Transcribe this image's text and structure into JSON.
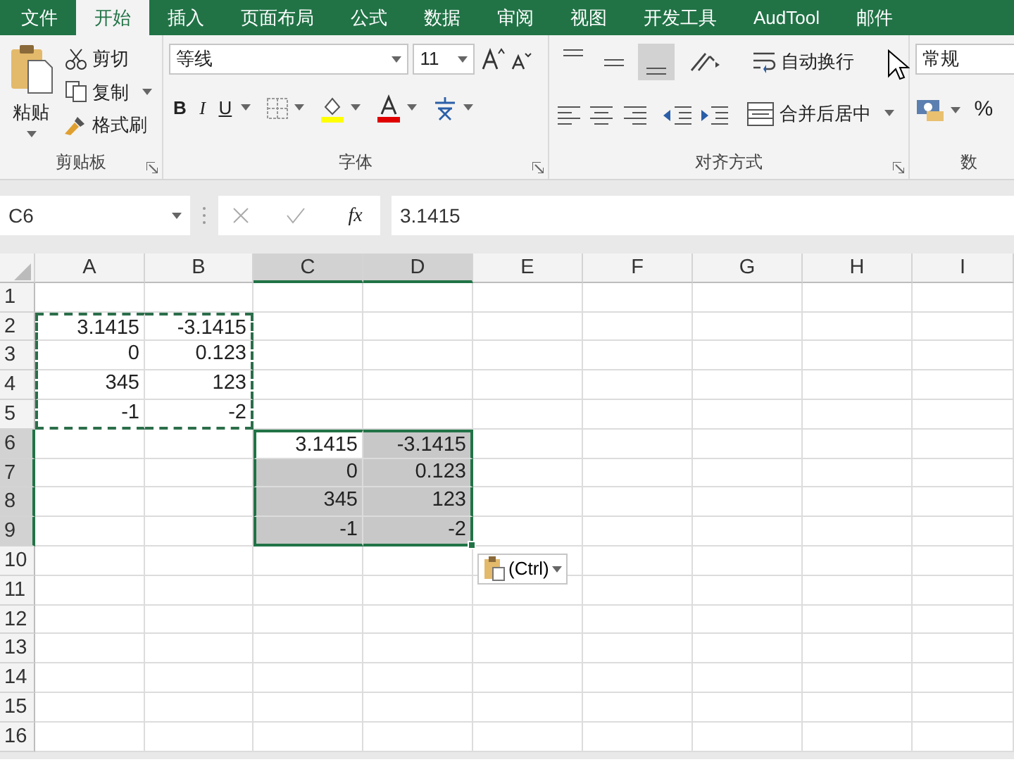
{
  "tabs": [
    {
      "label": "文件",
      "selected": false
    },
    {
      "label": "开始",
      "selected": true
    },
    {
      "label": "插入",
      "selected": false
    },
    {
      "label": "页面布局",
      "selected": false
    },
    {
      "label": "公式",
      "selected": false
    },
    {
      "label": "数据",
      "selected": false
    },
    {
      "label": "审阅",
      "selected": false
    },
    {
      "label": "视图",
      "selected": false
    },
    {
      "label": "开发工具",
      "selected": false
    },
    {
      "label": "AudTool",
      "selected": false
    },
    {
      "label": "邮件",
      "selected": false
    }
  ],
  "clipboard": {
    "paste": "粘贴",
    "cut": "剪切",
    "copy": "复制",
    "format_painter": "格式刷",
    "label": "剪贴板"
  },
  "font": {
    "name": "等线",
    "size": "11",
    "bold": "B",
    "italic": "I",
    "underline": "U",
    "label": "字体"
  },
  "alignment": {
    "vertical_buttons": [
      {
        "selected": false
      },
      {
        "selected": false
      },
      {
        "selected": true
      }
    ],
    "wrap_text": "自动换行",
    "merge": "合并后居中",
    "label": "对齐方式"
  },
  "number": {
    "format": "常规",
    "percent": "%",
    "label": "数"
  },
  "formula_bar": {
    "name_box": "C6",
    "function_label": "fx",
    "formula": "3.1415"
  },
  "sheet": {
    "columns": [
      {
        "label": "A",
        "selected": false
      },
      {
        "label": "B",
        "selected": false
      },
      {
        "label": "C",
        "selected": true
      },
      {
        "label": "D",
        "selected": true
      },
      {
        "label": "E",
        "selected": false
      },
      {
        "label": "F",
        "selected": false
      },
      {
        "label": "G",
        "selected": false
      },
      {
        "label": "H",
        "selected": false
      },
      {
        "label": "I",
        "selected": false
      }
    ],
    "rows": [
      {
        "label": "1",
        "selected": false,
        "cells": []
      },
      {
        "label": "2",
        "selected": false,
        "cells": [
          {
            "value": "3.1415",
            "copied": true,
            "selected": false
          },
          {
            "value": "-3.1415",
            "copied": true,
            "selected": false
          }
        ]
      },
      {
        "label": "3",
        "selected": false,
        "cells": [
          {
            "value": "0",
            "copied": true,
            "selected": false
          },
          {
            "value": "0.123",
            "copied": true,
            "selected": false
          }
        ]
      },
      {
        "label": "4",
        "selected": false,
        "cells": [
          {
            "value": "345",
            "copied": true,
            "selected": false
          },
          {
            "value": "123",
            "copied": true,
            "selected": false
          }
        ]
      },
      {
        "label": "5",
        "selected": false,
        "cells": [
          {
            "value": "-1",
            "copied": true,
            "selected": false
          },
          {
            "value": "-2",
            "copied": true,
            "selected": false
          }
        ]
      },
      {
        "label": "6",
        "selected": true,
        "cells": [
          null,
          null,
          {
            "value": "3.1415",
            "copied": false,
            "selected": true,
            "active": true
          },
          {
            "value": "-3.1415",
            "copied": false,
            "selected": true,
            "active": false
          }
        ]
      },
      {
        "label": "7",
        "selected": true,
        "cells": [
          null,
          null,
          {
            "value": "0",
            "copied": false,
            "selected": true,
            "active": false
          },
          {
            "value": "0.123",
            "copied": false,
            "selected": true,
            "active": false
          }
        ]
      },
      {
        "label": "8",
        "selected": true,
        "cells": [
          null,
          null,
          {
            "value": "345",
            "copied": false,
            "selected": true,
            "active": false
          },
          {
            "value": "123",
            "copied": false,
            "selected": true,
            "active": false
          }
        ]
      },
      {
        "label": "9",
        "selected": true,
        "cells": [
          null,
          null,
          {
            "value": "-1",
            "copied": false,
            "selected": true,
            "active": false
          },
          {
            "value": "-2",
            "copied": false,
            "selected": true,
            "active": false
          }
        ]
      },
      {
        "label": "10",
        "selected": false,
        "cells": []
      },
      {
        "label": "11",
        "selected": false,
        "cells": []
      },
      {
        "label": "12",
        "selected": false,
        "cells": []
      },
      {
        "label": "13",
        "selected": false,
        "cells": []
      },
      {
        "label": "14",
        "selected": false,
        "cells": []
      },
      {
        "label": "15",
        "selected": false,
        "cells": []
      },
      {
        "label": "16",
        "selected": false,
        "cells": []
      }
    ]
  },
  "paste_options": {
    "label": "(Ctrl)"
  }
}
